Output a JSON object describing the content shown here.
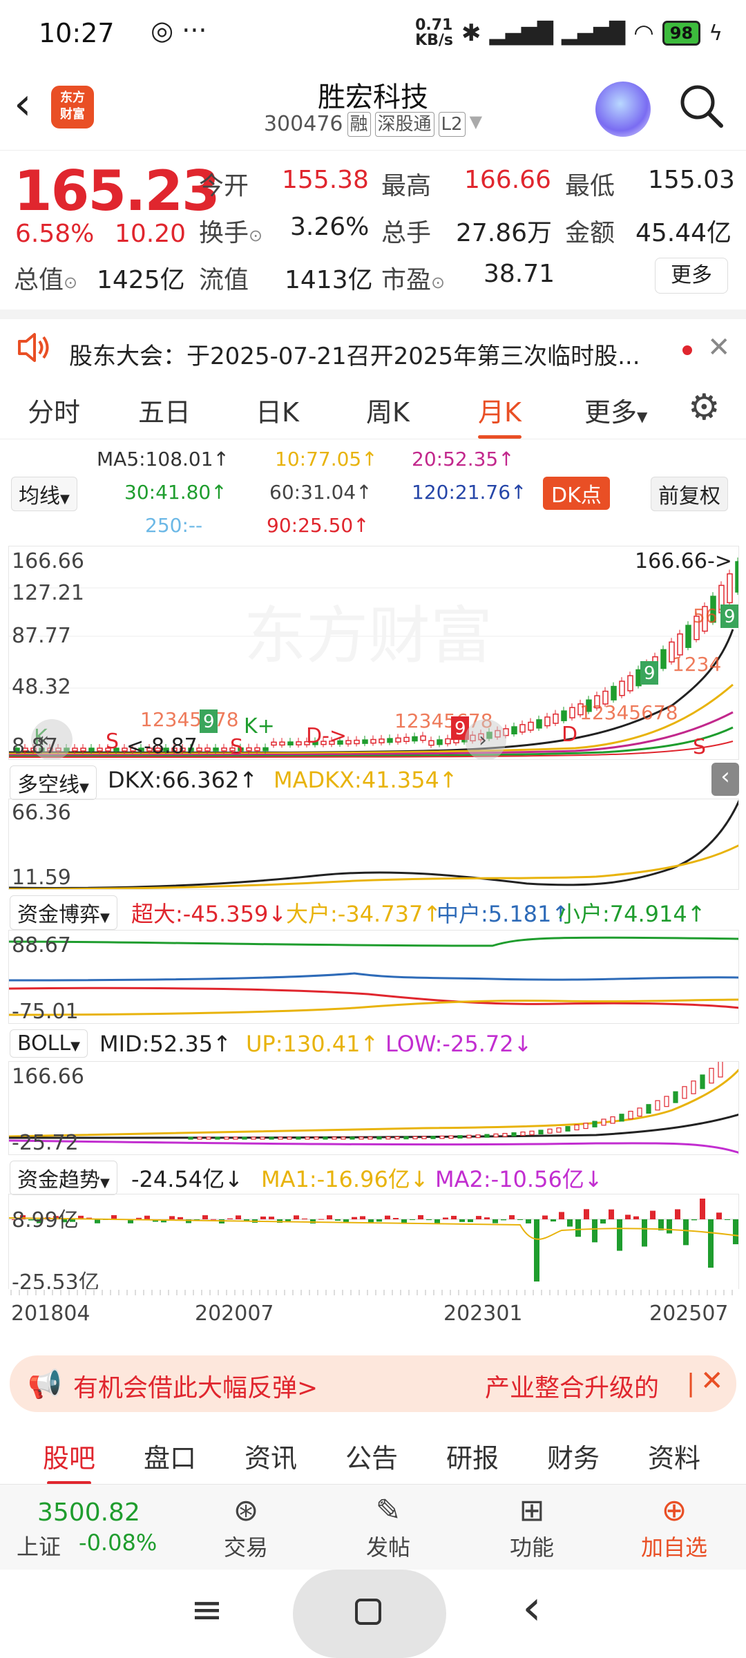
{
  "status": {
    "time": "10:27",
    "net_speed": "0.71\nKB/s",
    "battery": "98"
  },
  "header": {
    "logo_text": "东方\n财富",
    "stock_name": "胜宏科技",
    "stock_code": "300476",
    "tags": [
      "融",
      "深股通",
      "L2"
    ]
  },
  "quote": {
    "price": "165.23",
    "change_pct": "6.58%",
    "change": "10.20",
    "fields": [
      {
        "label": "今开",
        "value": "155.38"
      },
      {
        "label": "最高",
        "value": "166.66"
      },
      {
        "label": "最低",
        "value": "155.03"
      },
      {
        "label": "换手",
        "value": "3.26%"
      },
      {
        "label": "总手",
        "value": "27.86万"
      },
      {
        "label": "金额",
        "value": "45.44亿"
      },
      {
        "label": "总值",
        "value": "1425亿"
      },
      {
        "label": "流值",
        "value": "1413亿"
      },
      {
        "label": "市盈",
        "value": "38.71"
      }
    ],
    "more": "更多"
  },
  "notice": {
    "text": "股东大会：于2025-07-21召开2025年第三次临时股..."
  },
  "period_tabs": [
    "分时",
    "五日",
    "日K",
    "周K",
    "月K",
    "更多"
  ],
  "ma": {
    "selector": "均线",
    "ma5": "MA5:108.01↑",
    "ma10": "10:77.05↑",
    "ma20": "20:52.35↑",
    "ma30": "30:41.80↑",
    "ma60": "60:31.04↑",
    "ma120": "120:21.76↑",
    "ma250": "250:--",
    "ma90": "90:25.50↑",
    "dk_button": "DK点",
    "adjust": "前复权"
  },
  "kline": {
    "y_labels": [
      "166.66",
      "127.21",
      "87.77",
      "48.32",
      "8.87"
    ],
    "max_label": "166.66->",
    "min_label": "<-8.87"
  },
  "dkx": {
    "name": "多空线",
    "dkx": "DKX:66.362↑",
    "madkx": "MADKX:41.354↑",
    "y_top": "66.36",
    "y_bottom": "11.59"
  },
  "fund_game": {
    "name": "资金博弈",
    "super": "超大:-45.359↓",
    "large": "大户:-34.737↑",
    "mid": "中户:5.181↑",
    "small": "小户:74.914↑",
    "y_top": "88.67",
    "y_bottom": "-75.01"
  },
  "boll": {
    "name": "BOLL",
    "mid": "MID:52.35↑",
    "up": "UP:130.41↑",
    "low": "LOW:-25.72↓",
    "y_top": "166.66",
    "y_bottom": "-25.72"
  },
  "fund_trend": {
    "name": "资金趋势",
    "value": "-24.54亿↓",
    "ma1": "MA1:-16.96亿↓",
    "ma2": "MA2:-10.56亿↓",
    "y_top": "8.99亿",
    "y_bottom": "-25.53亿"
  },
  "x_axis": [
    "201804",
    "202007",
    "202301",
    "202507"
  ],
  "promo": {
    "left": "有机会借此大幅反弹>",
    "right": "产业整合升级的"
  },
  "sub_tabs": [
    "股吧",
    "盘口",
    "资讯",
    "公告",
    "研报",
    "财务",
    "资料"
  ],
  "bottom": {
    "index_value": "3500.82",
    "index_name": "上证",
    "index_change": "-0.08%",
    "items": [
      "交易",
      "发帖",
      "功能",
      "加自选"
    ]
  },
  "colors": {
    "accent": "#e94f25",
    "up": "#e0262e",
    "down": "#1f9d2e"
  }
}
